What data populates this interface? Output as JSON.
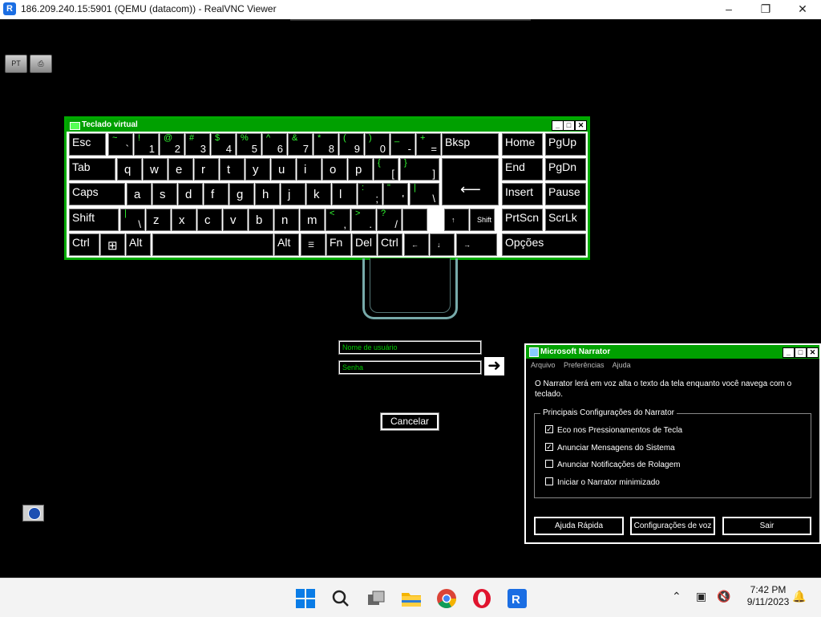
{
  "vnc": {
    "title": "186.209.240.15:5901 (QEMU (datacom)) - RealVNC Viewer",
    "logo": "R",
    "icons": [
      "minimize-icon",
      "restore-icon",
      "close-icon"
    ]
  },
  "toolbar": {
    "lang_label": "PT",
    "print_label": "⎙"
  },
  "keyboard": {
    "title": "Teclado virtual",
    "rows": [
      [
        {
          "label": "Esc"
        },
        {
          "up": "~",
          "lo": "`"
        },
        {
          "up": "!",
          "lo": "1"
        },
        {
          "up": "@",
          "lo": "2"
        },
        {
          "up": "#",
          "lo": "3"
        },
        {
          "up": "$",
          "lo": "4"
        },
        {
          "up": "%",
          "lo": "5"
        },
        {
          "up": "^",
          "lo": "6"
        },
        {
          "up": "&",
          "lo": "7"
        },
        {
          "up": "*",
          "lo": "8"
        },
        {
          "up": "(",
          "lo": "9"
        },
        {
          "up": ")",
          "lo": "0"
        },
        {
          "up": "_",
          "lo": "-"
        },
        {
          "up": "+",
          "lo": "="
        },
        {
          "label": "Bksp"
        },
        {
          "label": "Home"
        },
        {
          "label": "PgUp"
        }
      ],
      [
        {
          "label": "Tab"
        },
        {
          "mid": "q"
        },
        {
          "mid": "w"
        },
        {
          "mid": "e"
        },
        {
          "mid": "r"
        },
        {
          "mid": "t"
        },
        {
          "mid": "y"
        },
        {
          "mid": "u"
        },
        {
          "mid": "i"
        },
        {
          "mid": "o"
        },
        {
          "mid": "p"
        },
        {
          "up": "{",
          "lo": "["
        },
        {
          "up": "}",
          "lo": "]"
        },
        {
          "enter": "⟵"
        },
        {
          "label": "End"
        },
        {
          "label": "PgDn"
        }
      ],
      [
        {
          "label": "Caps"
        },
        {
          "mid": "a"
        },
        {
          "mid": "s"
        },
        {
          "mid": "d"
        },
        {
          "mid": "f"
        },
        {
          "mid": "g"
        },
        {
          "mid": "h"
        },
        {
          "mid": "j"
        },
        {
          "mid": "k"
        },
        {
          "mid": "l"
        },
        {
          "up": ":",
          "lo": ";"
        },
        {
          "up": "\"",
          "lo": "'"
        },
        {
          "up": "|",
          "lo": "\\"
        },
        {
          "label": "Insert"
        },
        {
          "label": "Pause"
        }
      ],
      [
        {
          "label": "Shift"
        },
        {
          "up": "|",
          "lo": "\\"
        },
        {
          "mid": "z"
        },
        {
          "mid": "x"
        },
        {
          "mid": "c"
        },
        {
          "mid": "v"
        },
        {
          "mid": "b"
        },
        {
          "mid": "n"
        },
        {
          "mid": "m"
        },
        {
          "up": "<",
          "lo": ","
        },
        {
          "up": ">",
          "lo": "."
        },
        {
          "up": "?",
          "lo": "/"
        },
        {
          "mid": ""
        },
        {
          "sml": "↑"
        },
        {
          "sml": "Shift"
        },
        {
          "label": "PrtScn"
        },
        {
          "label": "ScrLk"
        }
      ],
      [
        {
          "label": "Ctrl"
        },
        {
          "mid": "⊞"
        },
        {
          "label": "Alt"
        },
        {
          "mid": ""
        },
        {
          "label": "Alt"
        },
        {
          "sml": "☰"
        },
        {
          "label": "Fn"
        },
        {
          "label": "Del"
        },
        {
          "label": "Ctrl"
        },
        {
          "sml": "←"
        },
        {
          "sml": "↓"
        },
        {
          "sml": "→"
        },
        {
          "label": "Opções"
        }
      ]
    ]
  },
  "login": {
    "username_placeholder": "Nome de usuário",
    "password_placeholder": "Senha",
    "submit_glyph": "➜",
    "cancel_label": "Cancelar"
  },
  "narrator": {
    "title": "Microsoft Narrator",
    "menu": [
      "Arquivo",
      "Preferências",
      "Ajuda"
    ],
    "description": "O Narrator lerá em voz alta o texto da tela enquanto você navega com o teclado.",
    "group_label": "Principais Configurações do Narrator",
    "options": [
      {
        "label": "Eco nos Pressionamentos de Tecla",
        "checked": true
      },
      {
        "label": "Anunciar Mensagens do Sistema",
        "checked": true
      },
      {
        "label": "Anunciar Notificações de Rolagem",
        "checked": false
      },
      {
        "label": "Iniciar o Narrator minimizado",
        "checked": false
      }
    ],
    "buttons": [
      "Ajuda Rápida",
      "Configurações de voz",
      "Sair"
    ]
  },
  "taskbar": {
    "apps": [
      "windows-start-icon",
      "search-icon",
      "task-view-icon",
      "file-explorer-icon",
      "chrome-icon",
      "opera-icon",
      "realvnc-icon"
    ],
    "time": "7:42 PM",
    "date": "9/11/2023"
  }
}
